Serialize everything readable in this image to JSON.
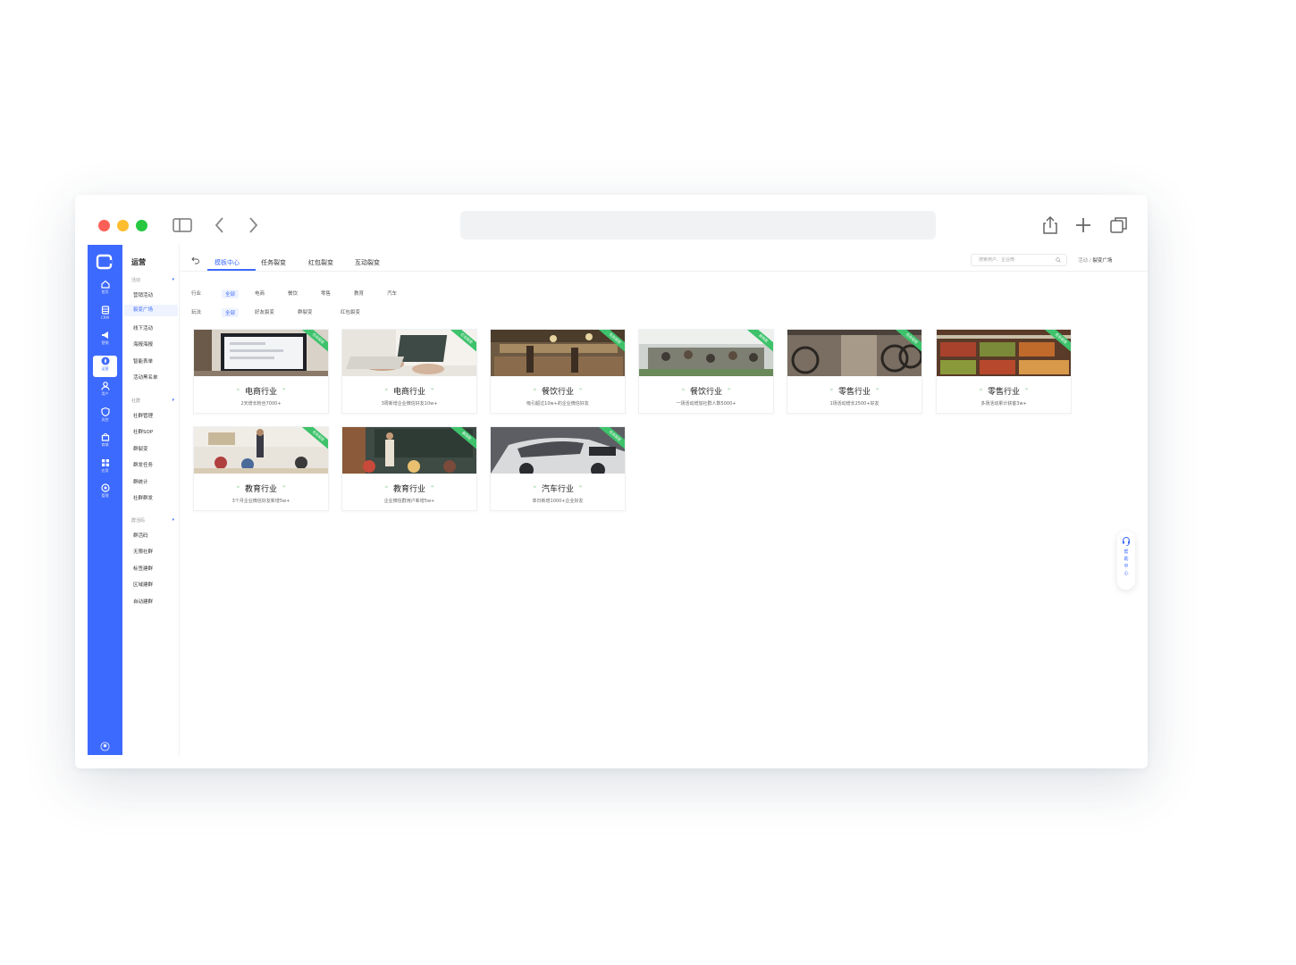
{
  "window": {
    "url": ""
  },
  "sidebar": {
    "items": [
      {
        "label": "首页",
        "icon": "home-icon"
      },
      {
        "label": "CRM",
        "icon": "database-icon"
      },
      {
        "label": "营销",
        "icon": "megaphone-icon"
      },
      {
        "label": "运营",
        "icon": "compass-icon",
        "active": true
      },
      {
        "label": "用户",
        "icon": "user-icon"
      },
      {
        "label": "风控",
        "icon": "shield-icon"
      },
      {
        "label": "商城",
        "icon": "bag-icon"
      },
      {
        "label": "应用",
        "icon": "grid-icon"
      },
      {
        "label": "管理",
        "icon": "settings-icon"
      }
    ]
  },
  "subnav": {
    "title": "运营",
    "groups": [
      {
        "label": "活动",
        "items": [
          "营销活动",
          "裂变广场",
          "线下活动",
          "海报海报",
          "智能表单",
          "活动黑名单"
        ]
      },
      {
        "label": "社群",
        "items": [
          "社群管理",
          "社群SOP",
          "群裂变",
          "群发任务",
          "群统计",
          "社群群发"
        ]
      },
      {
        "label": "群活码",
        "items": [
          "群活码",
          "无限社群",
          "标签建群",
          "区域建群",
          "自动建群"
        ]
      }
    ],
    "active_item": "裂变广场"
  },
  "tabs": [
    {
      "label": "模板中心",
      "active": true
    },
    {
      "label": "任务裂变"
    },
    {
      "label": "红包裂变"
    },
    {
      "label": "互动裂变"
    }
  ],
  "search": {
    "placeholder": "搜索用户、企业微"
  },
  "breadcrumb": {
    "parent": "活动",
    "separator": "/",
    "current": "裂变广场"
  },
  "filters": {
    "industry": {
      "label": "行业",
      "options": [
        "全部",
        "电商",
        "餐饮",
        "零售",
        "教育",
        "汽车"
      ],
      "selected": "全部"
    },
    "type": {
      "label": "玩法",
      "options": [
        "全部",
        "好友裂变",
        "群裂变",
        "红包裂变"
      ],
      "selected": "全部"
    }
  },
  "cards": [
    {
      "title": "电商行业",
      "desc": "2天增长粉丝7000+",
      "badge": "任务裂变",
      "scene": "laptop"
    },
    {
      "title": "电商行业",
      "desc": "3周新增企业微信好友10w+",
      "badge": "红包裂变",
      "scene": "typing"
    },
    {
      "title": "餐饮行业",
      "desc": "吸引超过10w+的企业微信好友",
      "badge": "任务裂变",
      "scene": "cafe"
    },
    {
      "title": "餐饮行业",
      "desc": "一场活动增加社群人数5000+",
      "badge": "群裂变",
      "scene": "market"
    },
    {
      "title": "零售行业",
      "desc": "1场活动增长2500+好友",
      "badge": "任务裂变",
      "scene": "bikes"
    },
    {
      "title": "零售行业",
      "desc": "多场活动累计获客3w+",
      "badge": "任务裂变",
      "scene": "produce"
    },
    {
      "title": "教育行业",
      "desc": "3个月企业微信好友新增5w+",
      "badge": "任务裂变",
      "scene": "class"
    },
    {
      "title": "教育行业",
      "desc": "企业微信群用户新增5w+",
      "badge": "群裂变",
      "scene": "blackboard"
    },
    {
      "title": "汽车行业",
      "desc": "单日新增1000+企业好友",
      "badge": "任务裂变",
      "scene": "car"
    }
  ],
  "help": {
    "label": "帮助中心"
  },
  "colors": {
    "brand": "#3d6afe",
    "badge": "#3ec26b"
  }
}
